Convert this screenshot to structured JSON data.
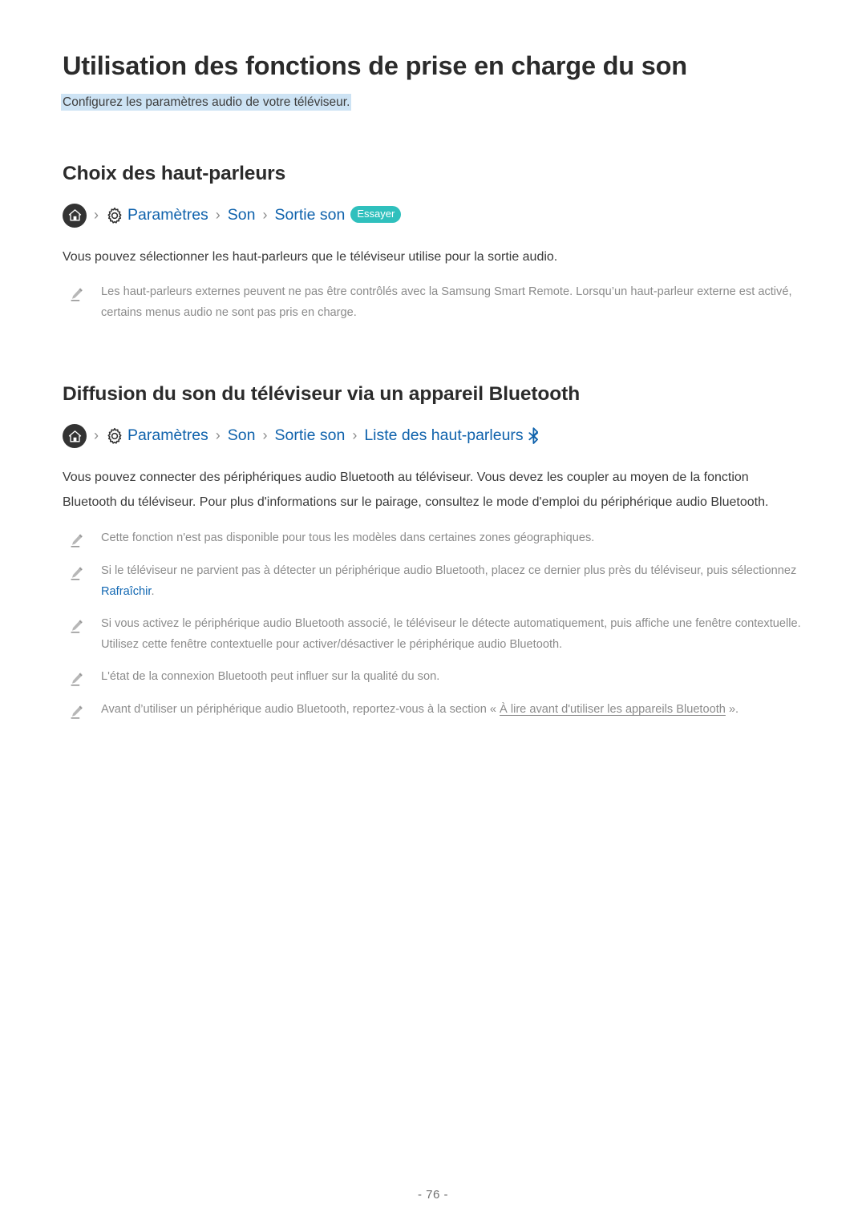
{
  "document": {
    "title": "Utilisation des fonctions de prise en charge du son",
    "subtitle": "Configurez les paramètres audio de votre téléviseur."
  },
  "colors": {
    "link_blue": "#0f62ac",
    "subtitle_highlight": "#cde3f4",
    "badge_teal": "#2fc0bd",
    "note_gray": "#8b8b8b",
    "separator_gray": "#8c8c8c"
  },
  "sections": [
    {
      "heading": "Choix des haut-parleurs",
      "breadcrumb": {
        "home_icon": "home-icon",
        "gear_icon": "gear-icon",
        "separator": "›",
        "crumbs": [
          "Paramètres",
          "Son",
          "Sortie son"
        ],
        "badge": "Essayer"
      },
      "body": "Vous pouvez sélectionner les haut-parleurs que le téléviseur utilise pour la sortie audio.",
      "notes": [
        {
          "icon": "pencil-icon",
          "text": "Les haut-parleurs externes peuvent ne pas être contrôlés avec la Samsung Smart Remote. Lorsqu’un haut-parleur externe est activé, certains menus audio ne sont pas pris en charge."
        }
      ]
    },
    {
      "heading": "Diffusion du son du téléviseur via un appareil Bluetooth",
      "breadcrumb": {
        "home_icon": "home-icon",
        "gear_icon": "gear-icon",
        "separator": "›",
        "crumbs": [
          "Paramètres",
          "Son",
          "Sortie son",
          "Liste des haut-parleurs"
        ],
        "trailing_icon": "bluetooth-icon"
      },
      "body": "Vous pouvez connecter des périphériques audio Bluetooth au téléviseur. Vous devez les coupler au moyen de la fonction Bluetooth du téléviseur. Pour plus d'informations sur le pairage, consultez le mode d'emploi du périphérique audio Bluetooth.",
      "notes": [
        {
          "icon": "pencil-icon",
          "text": "Cette fonction n'est pas disponible pour tous les modèles dans certaines zones géographiques."
        },
        {
          "icon": "pencil-icon",
          "text_before": "Si le téléviseur ne parvient pas à détecter un périphérique audio Bluetooth, placez ce dernier plus près du téléviseur, puis sélectionnez ",
          "highlight": "Rafraîchir",
          "text_after": "."
        },
        {
          "icon": "pencil-icon",
          "text": "Si vous activez le périphérique audio Bluetooth associé, le téléviseur le détecte automatiquement, puis affiche une fenêtre contextuelle. Utilisez cette fenêtre contextuelle pour activer/désactiver le périphérique audio Bluetooth."
        },
        {
          "icon": "pencil-icon",
          "text": "L'état de la connexion Bluetooth peut influer sur la qualité du son."
        },
        {
          "icon": "pencil-icon",
          "text_before": "Avant d’utiliser un périphérique audio Bluetooth, reportez-vous à la section « ",
          "link": "À lire avant d'utiliser les appareils Bluetooth",
          "text_after": " »."
        }
      ]
    }
  ],
  "footer": {
    "page_number": "- 76 -"
  }
}
